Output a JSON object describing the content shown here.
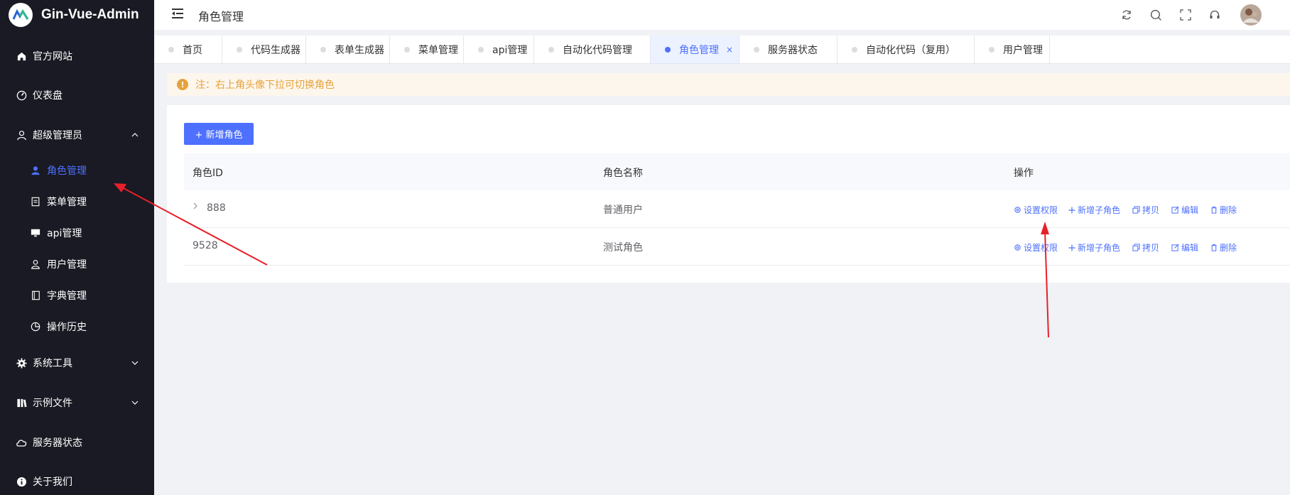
{
  "app": {
    "title": "Gin-Vue-Admin"
  },
  "sidebar": {
    "items": [
      {
        "label": "官方网站",
        "icon": "home-icon"
      },
      {
        "label": "仪表盘",
        "icon": "dashboard-icon"
      },
      {
        "label": "超级管理员",
        "icon": "user-icon",
        "expanded": true
      },
      {
        "label": "角色管理",
        "icon": "avatar-icon",
        "active": true
      },
      {
        "label": "菜单管理",
        "icon": "document-icon"
      },
      {
        "label": "api管理",
        "icon": "monitor-icon"
      },
      {
        "label": "用户管理",
        "icon": "user-icon"
      },
      {
        "label": "字典管理",
        "icon": "notebook-icon"
      },
      {
        "label": "操作历史",
        "icon": "pie-chart-icon"
      },
      {
        "label": "系统工具",
        "icon": "gear-icon"
      },
      {
        "label": "示例文件",
        "icon": "files-icon"
      },
      {
        "label": "服务器状态",
        "icon": "cloud-icon"
      },
      {
        "label": "关于我们",
        "icon": "info-icon"
      }
    ]
  },
  "header": {
    "title": "角色管理"
  },
  "tabs": [
    {
      "label": "首页"
    },
    {
      "label": "代码生成器"
    },
    {
      "label": "表单生成器"
    },
    {
      "label": "菜单管理"
    },
    {
      "label": "api管理"
    },
    {
      "label": "自动化代码管理"
    },
    {
      "label": "角色管理",
      "active": true,
      "close": "×"
    },
    {
      "label": "服务器状态"
    },
    {
      "label": "自动化代码（复用）"
    },
    {
      "label": "用户管理"
    }
  ],
  "alert": {
    "text": "注：右上角头像下拉可切换角色"
  },
  "toolbar": {
    "add_label": "+ 新增角色"
  },
  "table": {
    "headers": [
      "角色ID",
      "角色名称",
      "操作"
    ],
    "rows": [
      {
        "id": "888",
        "name": "普通用户",
        "expandable": true
      },
      {
        "id": "9528",
        "name": "测试角色",
        "expandable": false
      }
    ],
    "actions": [
      "设置权限",
      "新增子角色",
      "拷贝",
      "编辑",
      "删除"
    ]
  },
  "colors": {
    "sidebar_bg": "#191a23",
    "accent": "#4d70ff",
    "warning": "#e6a23c",
    "arrow": "#e8202a"
  }
}
